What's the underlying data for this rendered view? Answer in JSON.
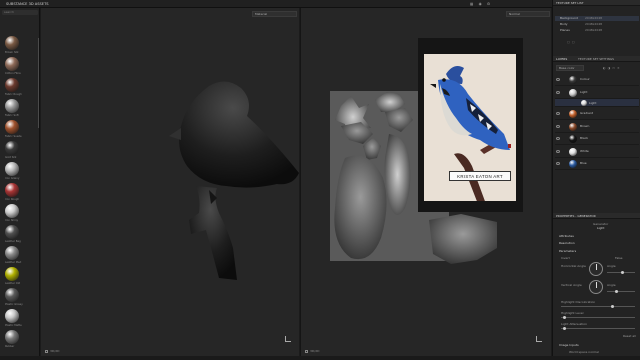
{
  "app": {
    "title": "SUBSTANCE 3D ASSETS"
  },
  "shelf": {
    "search_placeholder": "search",
    "materials": [
      {
        "label": "Brown Silk",
        "color": "#7a5a44"
      },
      {
        "label": "Cotton Fibre",
        "color": "#8e6a58"
      },
      {
        "label": "Fabric Rough",
        "color": "#6b3a2e"
      },
      {
        "label": "Fabric Soft",
        "color": "#9a9a9a"
      },
      {
        "label": "Fabric Suede",
        "color": "#a0522d"
      },
      {
        "label": "Gold Silk",
        "color": "#3a3a3a"
      },
      {
        "label": "Iron Grainy",
        "color": "#b8b8b8"
      },
      {
        "label": "Iron Rough",
        "color": "#a83434"
      },
      {
        "label": "Iron Shiny",
        "color": "#cccccc"
      },
      {
        "label": "Leather Bag",
        "color": "#505050"
      },
      {
        "label": "Leather Med",
        "color": "#8a8a8a"
      },
      {
        "label": "Leather Old",
        "color": "#b0b000"
      },
      {
        "label": "Plastic Glossy",
        "color": "#5a5a5a"
      },
      {
        "label": "Plastic Matte",
        "color": "#c8c8c8"
      },
      {
        "label": "Rubber",
        "color": "#7a7a7a"
      }
    ]
  },
  "viewport3d": {
    "mode_dropdown": "Material",
    "footer_label": "3D/2D"
  },
  "viewport2d": {
    "mode_dropdown": "Normal",
    "footer_label": "3D/2D"
  },
  "reference": {
    "caption": "KRISTA EATON ART"
  },
  "texture_set_list": {
    "header": "TEXTURE SET LIST",
    "sets": [
      {
        "name": "Background",
        "size": "2048x2048",
        "selected": true
      },
      {
        "name": "Body",
        "size": "2048x2048",
        "selected": false
      },
      {
        "name": "Planes",
        "size": "2048x2048",
        "selected": false
      }
    ]
  },
  "layers": {
    "tabs": [
      "LAYERS",
      "TEXTURE SET SETTINGS"
    ],
    "blend_dropdown": "Base color",
    "items": [
      {
        "name": "Colour",
        "thumb": "#3a3a3a",
        "sub": false
      },
      {
        "name": "Light",
        "thumb": "#cfcfcf",
        "sub": false
      },
      {
        "name": "Light",
        "thumb": "#dcdcdc",
        "sub": true
      },
      {
        "name": "Gradient",
        "thumb": "#c2602a",
        "sub": false
      },
      {
        "name": "Brown",
        "thumb": "#8a4a2a",
        "sub": false
      },
      {
        "name": "Black",
        "thumb": "#151515",
        "sub": false
      },
      {
        "name": "White",
        "thumb": "#e0e0e0",
        "sub": false
      },
      {
        "name": "Blue",
        "thumb": "#2a5aa0",
        "sub": false
      }
    ]
  },
  "properties": {
    "header": "PROPERTIES - GENERATOR",
    "generator_label": "Generator",
    "generator_name": "Light",
    "sections": [
      "Attributes",
      "Resolution",
      "Parameters"
    ],
    "params": {
      "invert": "Invert",
      "invert_value": "False",
      "horizontal_angle": "Horizontal Angle",
      "vertical_angle": "Vertical Angle",
      "angle_word": "Angle",
      "highlight_discoloration": "Highlight Discoloration",
      "highlight_level": "Highlight Level",
      "light_attenuation": "Light Attenuation",
      "reset": "Reset all"
    },
    "image_inputs": "Image Inputs",
    "world_space_normal": "World space normal"
  }
}
